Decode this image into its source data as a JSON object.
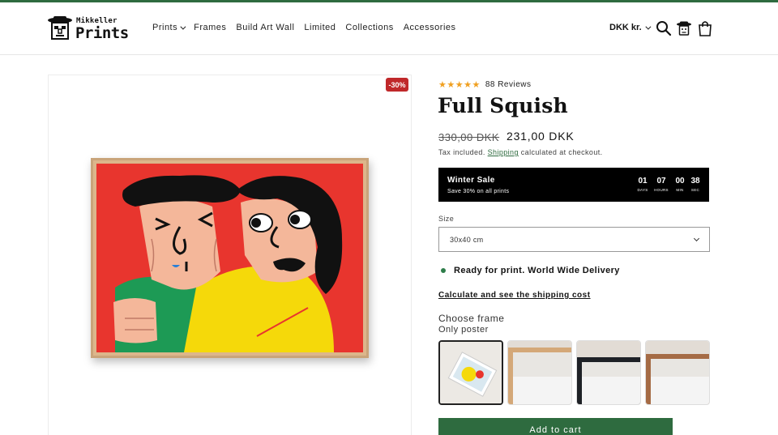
{
  "brand": {
    "small_text": "Mikkeller",
    "big_text": "Prints"
  },
  "nav": {
    "items": [
      {
        "label": "Prints",
        "has_dropdown": true
      },
      {
        "label": "Frames",
        "has_dropdown": false
      },
      {
        "label": "Build Art Wall",
        "has_dropdown": false
      },
      {
        "label": "Limited",
        "has_dropdown": false
      },
      {
        "label": "Collections",
        "has_dropdown": false
      },
      {
        "label": "Accessories",
        "has_dropdown": false
      }
    ]
  },
  "header": {
    "currency": "DKK kr.",
    "icons": [
      "search-icon",
      "account-icon",
      "cart-icon"
    ]
  },
  "gallery": {
    "discount_badge": "-30%",
    "image": "framed-poster-two-characters"
  },
  "product": {
    "rating_stars": "★★★★★",
    "review_count": "88 Reviews",
    "title": "Full Squish",
    "price_old": "330,00 DKK",
    "price_new": "231,00 DKK",
    "tax_prefix": "Tax included.",
    "tax_link": "Shipping",
    "tax_suffix": "calculated at checkout."
  },
  "sale_banner": {
    "title": "Winter Sale",
    "subtitle": "Save 30% on all prints",
    "countdown": [
      {
        "value": "01",
        "unit": "DAYS"
      },
      {
        "value": "07",
        "unit": "HOURS"
      },
      {
        "value": "00",
        "unit": "MIN"
      },
      {
        "value": "38",
        "unit": "SEC"
      }
    ]
  },
  "size": {
    "label": "Size",
    "selected": "30x40 cm"
  },
  "availability": {
    "text": "Ready for print. World Wide Delivery"
  },
  "shipping_link": "Calculate and see the shipping cost",
  "frame": {
    "label": "Choose frame",
    "selected_name": "Only poster",
    "options": [
      "only-poster",
      "oak-frame",
      "black-frame",
      "walnut-frame"
    ]
  },
  "cart_button": "Add to cart",
  "colors": {
    "accent_green": "#2e6b3f",
    "badge_red": "#c0282a",
    "star_gold": "#f0a020",
    "poster_red": "#e8352e"
  }
}
